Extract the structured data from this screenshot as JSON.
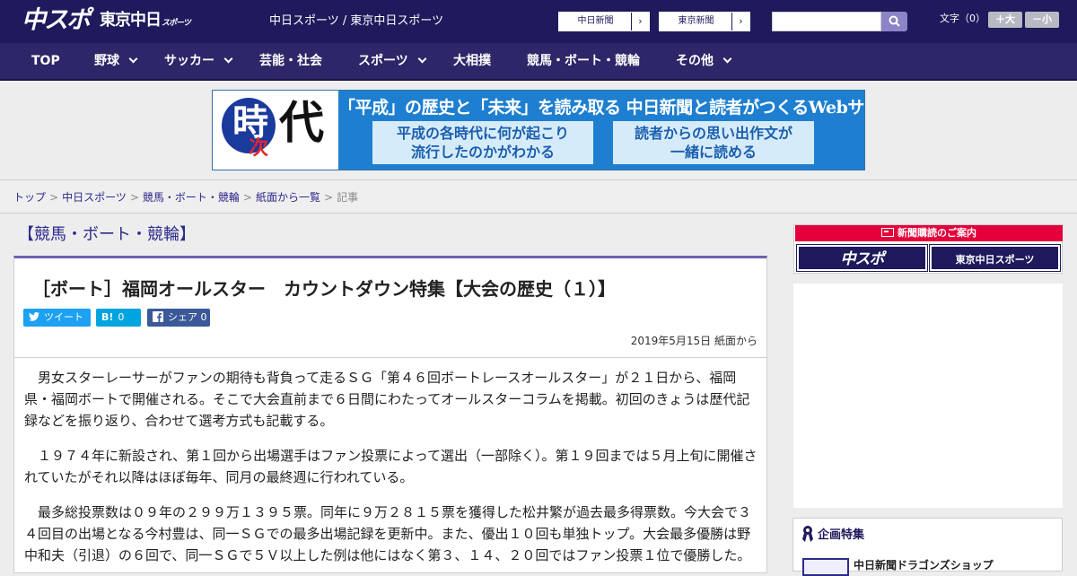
{
  "header": {
    "logo_chuspo": "中スポ",
    "logo_tokyo": "東京中日",
    "logo_tokyo_sub": "スポーツ",
    "site_title": "中日スポーツ / 東京中日スポーツ",
    "ext_links": [
      {
        "label": "中日新聞",
        "arrow": "›"
      },
      {
        "label": "東京新聞",
        "arrow": "›"
      }
    ],
    "search_placeholder": "",
    "font_size_label": "文字（0）",
    "font_up": "＋大",
    "font_down": "－小",
    "search_icon": "search-icon"
  },
  "nav": [
    {
      "label": "TOP",
      "has_menu": false
    },
    {
      "label": "野球",
      "has_menu": true
    },
    {
      "label": "サッカー",
      "has_menu": true
    },
    {
      "label": "芸能・社会",
      "has_menu": false
    },
    {
      "label": "スポーツ",
      "has_menu": true
    },
    {
      "label": "大相撲",
      "has_menu": false
    },
    {
      "label": "競馬・ボート・競輪",
      "has_menu": false
    },
    {
      "label": "その他",
      "has_menu": true
    }
  ],
  "banner": {
    "logo_ji": "時",
    "logo_tsugi": "次",
    "logo_dai": "代",
    "headline": "「平成」の歴史と「未来」を読み取る 中日新聞と読者がつくるWebサイト",
    "box1": [
      "平成の各時代に何が起こり",
      "流行したのかがわかる"
    ],
    "box2": [
      "読者からの思い出作文が",
      "一緒に読める"
    ]
  },
  "breadcrumb": {
    "items": [
      "トップ",
      "中日スポーツ",
      "競馬・ボート・競輪",
      "紙面から一覧"
    ],
    "current": "記事",
    "separator": ">"
  },
  "article": {
    "section": "【競馬・ボート・競輪】",
    "title": "［ボート］福岡オールスター　カウントダウン特集【大会の歴史（１）】",
    "share": {
      "tweet": "ツイート",
      "hatena_icon": "B!",
      "hatena_count": "0",
      "fb_label": "シェア",
      "fb_count": "0",
      "accent_colors": {
        "twitter": "#1da1f2",
        "hatena": "#00a4de",
        "facebook": "#3b5998"
      }
    },
    "date": "2019年5月15日 紙面から",
    "paragraphs": [
      "　男女スターレーサーがファンの期待も背負って走るＳＧ「第４６回ボートレースオールスター」が２１日から、福岡県・福岡ボートで開催される。そこで大会直前まで６日間にわたってオールスターコラムを掲載。初回のきょうは歴代記録などを振り返り、合わせて選考方式も記載する。",
      "　１９７４年に新設され、第１回から出場選手はファン投票によって選出（一部除く）。第１９回までは５月上旬に開催されていたがそれ以降はほぼ毎年、同月の最終週に行われている。",
      "　最多総投票数は０９年の２９９万１３９５票。同年に９万２８１５票を獲得した松井繁が過去最多得票数。今大会で３４回目の出場となる今村豊は、同一ＳＧでの最多出場記録を更新中。また、優出１０回も単独トップ。大会最多優勝は野中和夫（引退）の６回で、同一ＳＧで５Ｖ以上した例は他にはなく第３、１４、２０回ではファン投票１位で優勝した。"
    ]
  },
  "sidebar": {
    "subscribe_head": "新聞購読のご案内",
    "subscribe_logos": [
      "中スポ",
      "東京中日スポーツ"
    ],
    "feature_title": "企画特集",
    "feature_item": "中日新聞ドラゴンズショップ"
  },
  "colors": {
    "header_bg": "#1f1a5c",
    "nav_bg": "#2d2668",
    "accent_purple": "#6d62ad",
    "link": "#2d2a8a",
    "subscribe_red": "#e4003b"
  }
}
